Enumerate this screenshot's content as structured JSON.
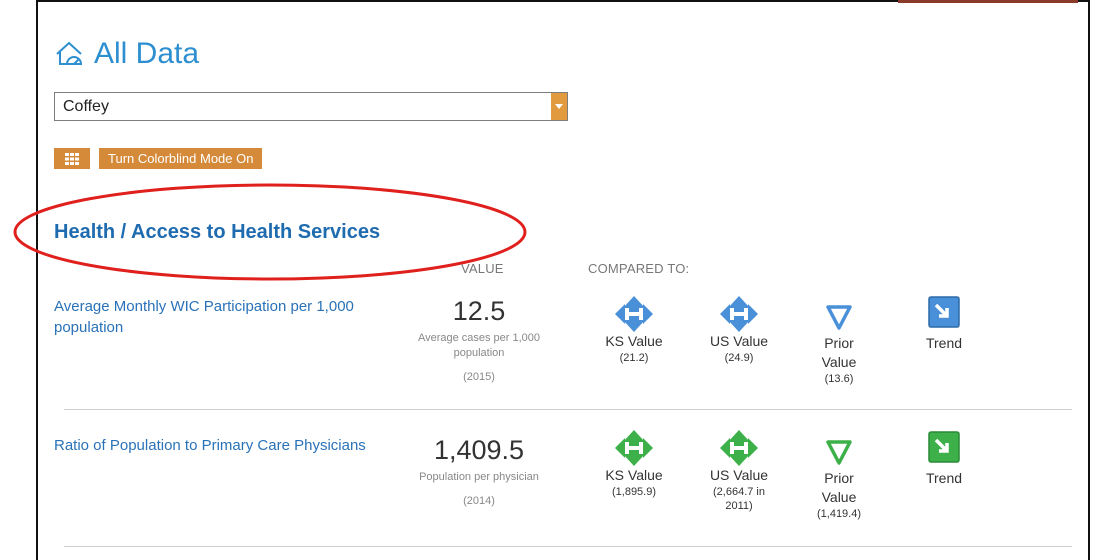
{
  "page": {
    "title": "All Data"
  },
  "county_select": {
    "value": "Coffey"
  },
  "toolbar": {
    "colorblind_label": "Turn Colorblind Mode On"
  },
  "section": {
    "heading": "Health / Access to Health Services"
  },
  "columns": {
    "value": "VALUE",
    "compared": "COMPARED TO:"
  },
  "indicators": [
    {
      "name": "Average Monthly WIC Participation per 1,000 population",
      "value": "12.5",
      "value_desc": "Average cases per 1,000 population",
      "year": "(2015)",
      "ks_label": "KS Value",
      "ks_sub": "(21.2)",
      "us_label": "US Value",
      "us_sub": "(24.9)",
      "prior_label": "Prior Value",
      "prior_sub": "(13.6)",
      "trend_label": "Trend",
      "color": "#4a90d9"
    },
    {
      "name": "Ratio of Population to Primary Care Physicians",
      "value": "1,409.5",
      "value_desc": "Population per physician",
      "year": "(2014)",
      "ks_label": "KS Value",
      "ks_sub": "(1,895.9)",
      "us_label": "US Value",
      "us_sub": "(2,664.7 in 2011)",
      "prior_label": "Prior Value",
      "prior_sub": "(1,419.4)",
      "trend_label": "Trend",
      "color": "#3db04a"
    }
  ],
  "icons": [
    "home-gauge-icon",
    "grid-icon",
    "diamond-compare-icon",
    "down-triangle-icon",
    "trend-arrow-icon"
  ],
  "colors": {
    "title": "#2d8fd0",
    "button": "#d58a3a",
    "heading": "#1e6bb0",
    "highlight": "#e0201c"
  }
}
